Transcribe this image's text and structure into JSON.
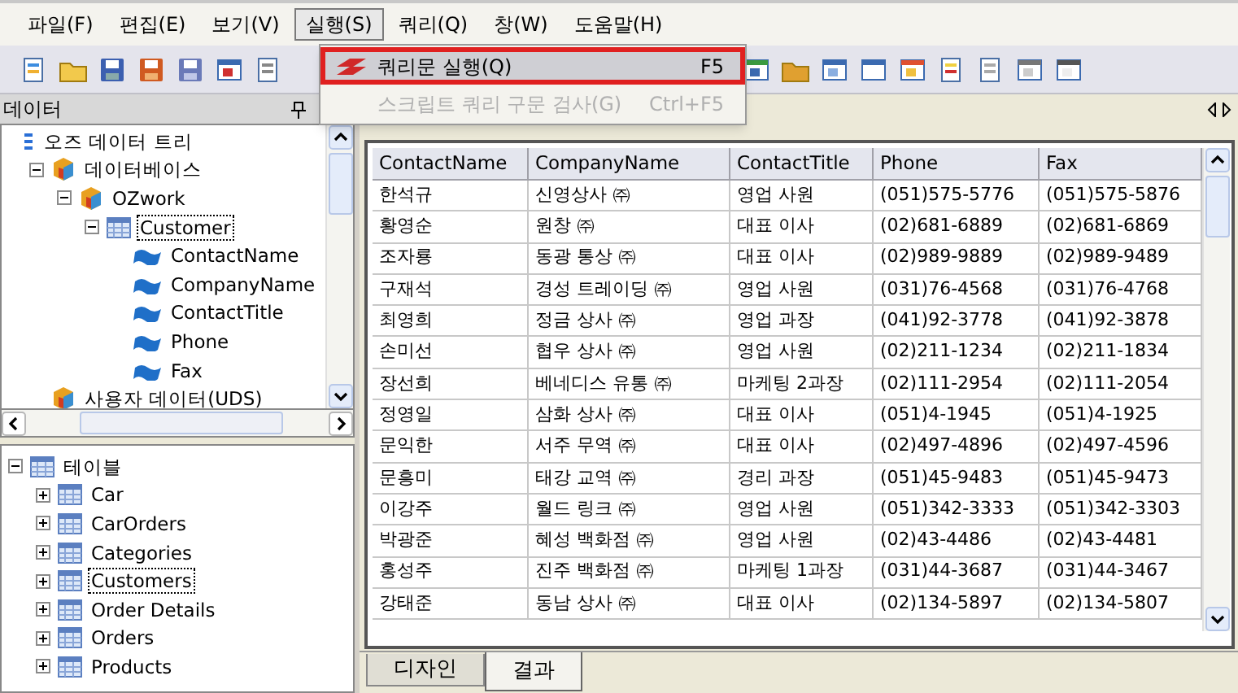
{
  "menu": [
    {
      "label": "파일(F)",
      "selected": false
    },
    {
      "label": "편집(E)",
      "selected": false
    },
    {
      "label": "보기(V)",
      "selected": false
    },
    {
      "label": "실행(S)",
      "selected": true
    },
    {
      "label": "쿼리(Q)",
      "selected": false
    },
    {
      "label": "창(W)",
      "selected": false
    },
    {
      "label": "도움말(H)",
      "selected": false
    }
  ],
  "dropdown": [
    {
      "label": "쿼리문 실행(Q)",
      "shortcut": "F5",
      "selected": true,
      "disabled": false
    },
    {
      "label": "스크립트 쿼리 구문 검사(G)",
      "shortcut": "Ctrl+F5",
      "selected": false,
      "disabled": true
    }
  ],
  "panel": {
    "title": "데이터"
  },
  "data_tree": [
    {
      "label": "오즈 데이터 트리",
      "kind": "root",
      "selected": false,
      "children": [
        {
          "label": "데이터베이스",
          "kind": "database",
          "expanded": true,
          "selected": false,
          "children": [
            {
              "label": "OZwork",
              "kind": "database",
              "expanded": true,
              "selected": false,
              "children": [
                {
                  "label": "Customer",
                  "kind": "table",
                  "expanded": true,
                  "selected": true,
                  "children": [
                    {
                      "label": "ContactName",
                      "kind": "field",
                      "selected": false
                    },
                    {
                      "label": "CompanyName",
                      "kind": "field",
                      "selected": false
                    },
                    {
                      "label": "ContactTitle",
                      "kind": "field",
                      "selected": false
                    },
                    {
                      "label": "Phone",
                      "kind": "field",
                      "selected": false
                    },
                    {
                      "label": "Fax",
                      "kind": "field",
                      "selected": false
                    }
                  ]
                }
              ]
            }
          ]
        },
        {
          "label": "사용자 데이터(UDS)",
          "kind": "database",
          "selected": false
        }
      ]
    }
  ],
  "table_tree": [
    {
      "label": "테이블",
      "kind": "table",
      "expanded": true,
      "selected": false,
      "children": [
        {
          "label": "Car",
          "kind": "table",
          "expanded": false,
          "selected": false
        },
        {
          "label": "CarOrders",
          "kind": "table",
          "expanded": false,
          "selected": false
        },
        {
          "label": "Categories",
          "kind": "table",
          "expanded": false,
          "selected": false
        },
        {
          "label": "Customers",
          "kind": "table",
          "expanded": false,
          "selected": true
        },
        {
          "label": "Order Details",
          "kind": "table",
          "expanded": false,
          "selected": false
        },
        {
          "label": "Orders",
          "kind": "table",
          "expanded": false,
          "selected": false
        },
        {
          "label": "Products",
          "kind": "table",
          "expanded": false,
          "selected": false
        }
      ]
    }
  ],
  "table": {
    "columns": [
      "ContactName",
      "CompanyName",
      "ContactTitle",
      "Phone",
      "Fax"
    ],
    "rows": [
      [
        "한석규",
        "신영상사 ㈜",
        "영업 사원",
        "(051)575-5776",
        "(051)575-5876"
      ],
      [
        "황영순",
        "원창 ㈜",
        "대표 이사",
        "(02)681-6889",
        "(02)681-6869"
      ],
      [
        "조자룡",
        "동광 통상 ㈜",
        "대표 이사",
        "(02)989-9889",
        "(02)989-9489"
      ],
      [
        "구재석",
        "경성 트레이딩 ㈜",
        "영업 사원",
        "(031)76-4568",
        "(031)76-4768"
      ],
      [
        "최영희",
        "정금 상사 ㈜",
        "영업 과장",
        "(041)92-3778",
        "(041)92-3878"
      ],
      [
        "손미선",
        "협우 상사 ㈜",
        "영업 사원",
        "(02)211-1234",
        "(02)211-1834"
      ],
      [
        "장선희",
        "베네디스 유통 ㈜",
        "마케팅 2과장",
        "(02)111-2954",
        "(02)111-2054"
      ],
      [
        "정영일",
        "삼화 상사 ㈜",
        "대표 이사",
        "(051)4-1945",
        "(051)4-1925"
      ],
      [
        "문익한",
        "서주 무역 ㈜",
        "대표 이사",
        "(02)497-4896",
        "(02)497-4596"
      ],
      [
        "문흥미",
        "태강 교역 ㈜",
        "경리 과장",
        "(051)45-9483",
        "(051)45-9473"
      ],
      [
        "이강주",
        "월드 링크 ㈜",
        "영업 사원",
        "(051)342-3333",
        "(051)342-3303"
      ],
      [
        "박광준",
        "혜성 백화점 ㈜",
        "영업 사원",
        "(02)43-4486",
        "(02)43-4481"
      ],
      [
        "홍성주",
        "진주 백화점 ㈜",
        "마케팅 1과장",
        "(031)44-3687",
        "(031)44-3467"
      ],
      [
        "강태준",
        "동남 상사 ㈜",
        "대표 이사",
        "(02)134-5897",
        "(02)134-5807"
      ]
    ]
  },
  "bottom_tabs": [
    {
      "label": "디자인",
      "selected": false
    },
    {
      "label": "결과",
      "selected": true
    }
  ]
}
